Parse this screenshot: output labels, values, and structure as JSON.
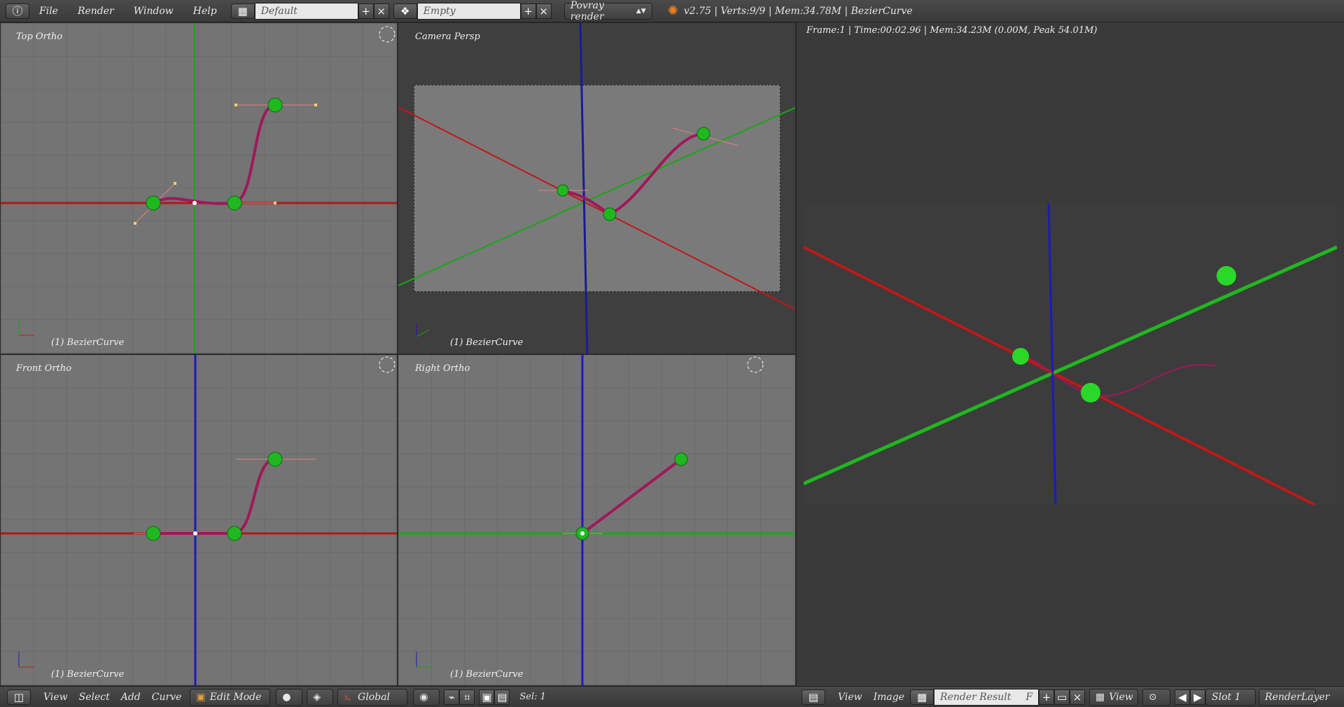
{
  "header": {
    "info_icon": "info-icon",
    "menus": [
      "File",
      "Render",
      "Window",
      "Help"
    ],
    "screen_layout": "Default",
    "scene": "Empty",
    "render_engine": "Povray render",
    "stats": "v2.75 | Verts:9/9 | Mem:34.78M | BezierCurve"
  },
  "viewports": {
    "top": {
      "title": "Top Ortho",
      "footer": "(1) BezierCurve"
    },
    "camera": {
      "title": "Camera Persp",
      "footer": "(1) BezierCurve"
    },
    "front": {
      "title": "Front Ortho",
      "footer": "(1) BezierCurve"
    },
    "right": {
      "title": "Right Ortho",
      "footer": "(1) BezierCurve"
    }
  },
  "view3d_header": {
    "menus": [
      "View",
      "Select",
      "Add",
      "Curve"
    ],
    "mode": "Edit Mode",
    "orientation": "Global",
    "selection": "Sel: 1"
  },
  "image_editor": {
    "frame_info": "Frame:1 | Time:00:02.96 | Mem:34.23M (0.00M, Peak 54.01M)",
    "menus": [
      "View",
      "Image"
    ],
    "image_name": "Render Result",
    "fake_user": "F",
    "view": "View",
    "slot": "Slot 1",
    "layer": "RenderLayer"
  },
  "colors": {
    "x_axis": "#c01818",
    "y_axis": "#18a818",
    "z_axis": "#1a1ac0",
    "curve": "#a0185a",
    "sphere": "#20c020"
  }
}
